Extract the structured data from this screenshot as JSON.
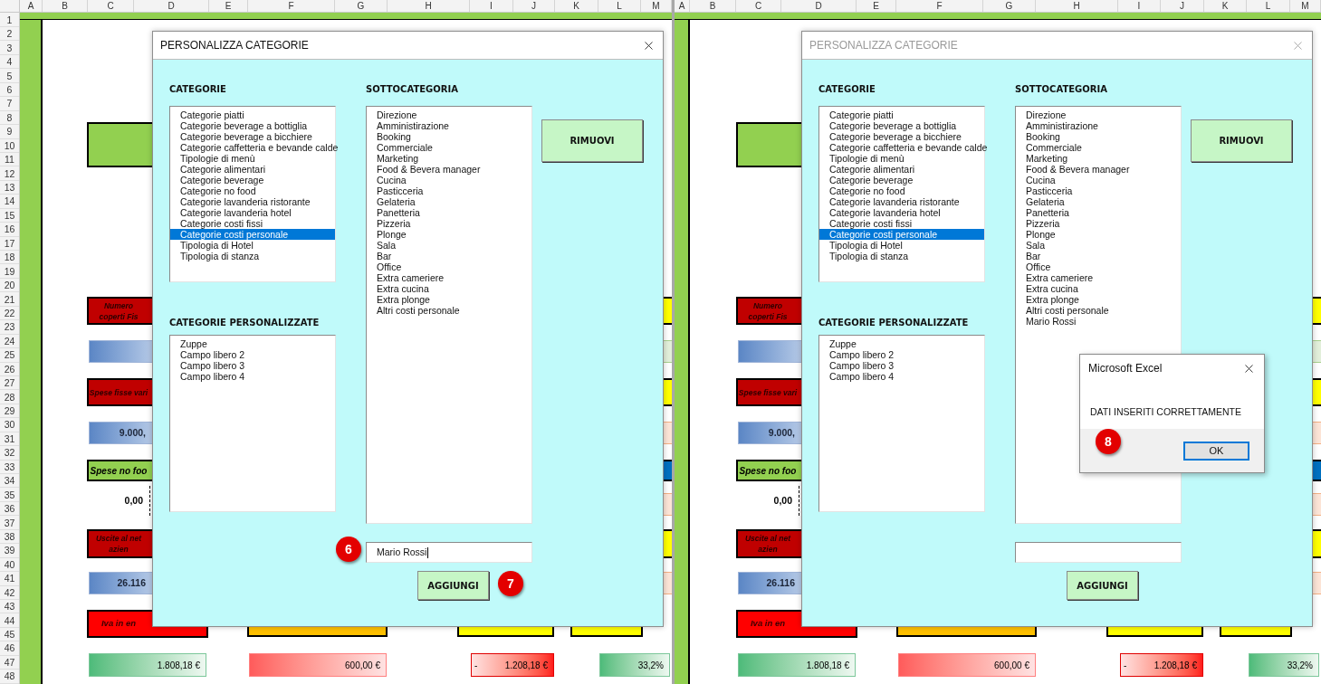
{
  "panels": [
    {
      "columns": [
        "A",
        "B",
        "C",
        "D",
        "E",
        "F",
        "G",
        "H",
        "I",
        "J",
        "K",
        "L",
        "M"
      ],
      "rows": [
        "1",
        "2",
        "3",
        "4",
        "5",
        "6",
        "7",
        "8",
        "9",
        "10",
        "11",
        "12",
        "13",
        "14",
        "15",
        "16",
        "17",
        "18",
        "19",
        "20",
        "21",
        "22",
        "23",
        "24",
        "25",
        "26",
        "27",
        "28",
        "29",
        "30",
        "31",
        "32",
        "33",
        "34",
        "35",
        "36",
        "37",
        "38",
        "39",
        "40",
        "41",
        "42",
        "43",
        "44",
        "45",
        "46",
        "47",
        "48"
      ],
      "cells": [
        {
          "kind": "green"
        },
        {
          "kind": "red",
          "lines": [
            "Numero",
            "coperti Fis"
          ]
        },
        {
          "kind": "blue"
        },
        {
          "kind": "red",
          "lines": [
            "Spese fisse vari"
          ]
        },
        {
          "kind": "blue",
          "lines": [
            "9.000,"
          ]
        },
        {
          "kind": "green",
          "lines": [
            "Spese no foo"
          ]
        },
        {
          "kind": "plain",
          "lines": [
            "0,00"
          ]
        },
        {
          "kind": "red",
          "lines": [
            "Uscite al net",
            "azien"
          ]
        },
        {
          "kind": "blue",
          "lines": [
            "26.116"
          ]
        },
        {
          "kind": "bright-red",
          "lines": [
            "Iva in en"
          ]
        },
        {
          "kind": "green-grad",
          "lines": [
            "1.808,18 €"
          ]
        },
        {
          "kind": "orange"
        },
        {
          "kind": "red-grad",
          "lines": [
            "600,00 €"
          ]
        },
        {
          "kind": "yellow"
        },
        {
          "kind": "red-grad-rev",
          "sign": "-",
          "lines": [
            "1.208,18 €"
          ]
        },
        {
          "kind": "yellow"
        },
        {
          "kind": "green-grad",
          "lines": [
            "33,2%"
          ]
        },
        {
          "kind": "yellow"
        },
        {
          "kind": "mint"
        },
        {
          "kind": "yellow"
        },
        {
          "kind": "peach"
        },
        {
          "kind": "navy"
        },
        {
          "kind": "peach"
        },
        {
          "kind": "yellow"
        },
        {
          "kind": "peach"
        }
      ],
      "dialog": {
        "title": "PERSONALIZZA CATEGORIE",
        "active": true,
        "categories_label": "CATEGORIE",
        "categories": [
          {
            "label": "Categorie piatti",
            "selected": false
          },
          {
            "label": "Categorie beverage a bottiglia",
            "selected": false
          },
          {
            "label": "Categorie beverage a bicchiere",
            "selected": false
          },
          {
            "label": "Categorie caffetteria e bevande calde",
            "selected": false
          },
          {
            "label": "Tipologie di menù",
            "selected": false
          },
          {
            "label": "Categorie alimentari",
            "selected": false
          },
          {
            "label": "Categorie beverage",
            "selected": false
          },
          {
            "label": "Categorie no food",
            "selected": false
          },
          {
            "label": "Categorie lavanderia ristorante",
            "selected": false
          },
          {
            "label": "Categorie lavanderia hotel",
            "selected": false
          },
          {
            "label": "Categorie costi fissi",
            "selected": false
          },
          {
            "label": "Categorie costi personale",
            "selected": true
          },
          {
            "label": "Tipologia di Hotel",
            "selected": false
          },
          {
            "label": "Tipologia di stanza",
            "selected": false
          }
        ],
        "custom_label": "CATEGORIE PERSONALIZZATE",
        "custom": [
          "Zuppe",
          "Campo libero 2",
          "Campo libero 3",
          "Campo libero 4"
        ],
        "sub_label": "SOTTOCATEGORIA",
        "subcategories": [
          "Direzione",
          "Amministirazione",
          "Booking",
          "Commerciale",
          "Marketing",
          "Food & Bevera manager",
          "Cucina",
          "Pasticceria",
          "Gelateria",
          "Panetteria",
          "Pizzeria",
          "Plonge",
          "Sala",
          "Bar",
          "Office",
          "Extra cameriere",
          "Extra cucina",
          "Extra plonge",
          "Altri costi personale"
        ],
        "remove_button": "RIMUOVI",
        "input": {
          "value": "Mario Rossi",
          "focused": true
        },
        "add_button": "AGGIUNGI"
      },
      "badges": [
        "6",
        "7"
      ]
    },
    {
      "columns": [
        "A",
        "B",
        "C",
        "D",
        "E",
        "F",
        "G",
        "H",
        "I",
        "J",
        "K",
        "L",
        "M"
      ],
      "cells": [
        {
          "kind": "green"
        },
        {
          "kind": "red",
          "lines": [
            "Numero",
            "coperti Fis"
          ]
        },
        {
          "kind": "blue"
        },
        {
          "kind": "red",
          "lines": [
            "Spese fisse vari"
          ]
        },
        {
          "kind": "blue",
          "lines": [
            "9.000,"
          ]
        },
        {
          "kind": "green",
          "lines": [
            "Spese no foo"
          ]
        },
        {
          "kind": "plain",
          "lines": [
            "0,00"
          ]
        },
        {
          "kind": "red",
          "lines": [
            "Uscite al net",
            "azien"
          ]
        },
        {
          "kind": "blue",
          "lines": [
            "26.116"
          ]
        },
        {
          "kind": "bright-red",
          "lines": [
            "Iva in en"
          ]
        },
        {
          "kind": "green-grad",
          "lines": [
            "1.808,18 €"
          ]
        },
        {
          "kind": "orange"
        },
        {
          "kind": "red-grad",
          "lines": [
            "600,00 €"
          ]
        },
        {
          "kind": "yellow"
        },
        {
          "kind": "red-grad-rev",
          "sign": "-",
          "lines": [
            "1.208,18 €"
          ]
        },
        {
          "kind": "yellow"
        },
        {
          "kind": "green-grad",
          "lines": [
            "33,2%"
          ]
        },
        {
          "kind": "yellow"
        },
        {
          "kind": "mint"
        },
        {
          "kind": "yellow"
        },
        {
          "kind": "peach"
        },
        {
          "kind": "navy"
        },
        {
          "kind": "peach"
        },
        {
          "kind": "yellow"
        },
        {
          "kind": "peach"
        }
      ],
      "dialog": {
        "title": "PERSONALIZZA CATEGORIE",
        "active": false,
        "categories_label": "CATEGORIE",
        "categories": [
          {
            "label": "Categorie piatti",
            "selected": false
          },
          {
            "label": "Categorie beverage a bottiglia",
            "selected": false
          },
          {
            "label": "Categorie beverage a bicchiere",
            "selected": false
          },
          {
            "label": "Categorie caffetteria e bevande calde",
            "selected": false
          },
          {
            "label": "Tipologie di menù",
            "selected": false
          },
          {
            "label": "Categorie alimentari",
            "selected": false
          },
          {
            "label": "Categorie beverage",
            "selected": false
          },
          {
            "label": "Categorie no food",
            "selected": false
          },
          {
            "label": "Categorie lavanderia ristorante",
            "selected": false
          },
          {
            "label": "Categorie lavanderia hotel",
            "selected": false
          },
          {
            "label": "Categorie costi fissi",
            "selected": false
          },
          {
            "label": "Categorie costi personale",
            "selected": true
          },
          {
            "label": "Tipologia di Hotel",
            "selected": false
          },
          {
            "label": "Tipologia di stanza",
            "selected": false
          }
        ],
        "custom_label": "CATEGORIE PERSONALIZZATE",
        "custom": [
          "Zuppe",
          "Campo libero 2",
          "Campo libero 3",
          "Campo libero 4"
        ],
        "sub_label": "SOTTOCATEGORIA",
        "subcategories": [
          "Direzione",
          "Amministirazione",
          "Booking",
          "Commerciale",
          "Marketing",
          "Food & Bevera manager",
          "Cucina",
          "Pasticceria",
          "Gelateria",
          "Panetteria",
          "Pizzeria",
          "Plonge",
          "Sala",
          "Bar",
          "Office",
          "Extra cameriere",
          "Extra cucina",
          "Extra plonge",
          "Altri costi personale",
          "Mario Rossi"
        ],
        "remove_button": "RIMUOVI",
        "input": {
          "focused": false
        },
        "add_button": "AGGIUNGI"
      },
      "message_box": {
        "title": "Microsoft Excel",
        "message": "DATI INSERITI CORRETTAMENTE",
        "button": "OK"
      },
      "badges": [
        "8"
      ]
    }
  ]
}
